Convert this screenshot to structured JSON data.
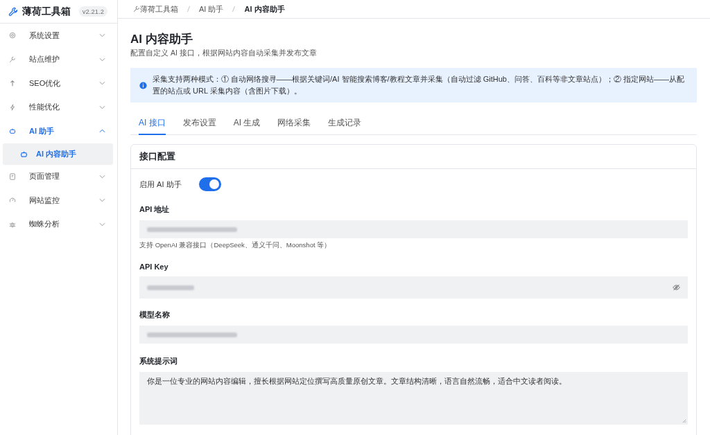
{
  "sidebar": {
    "brand": "薄荷工具箱",
    "version": "v2.21.2",
    "items": [
      {
        "label": "系统设置",
        "expanded": false,
        "selected": false
      },
      {
        "label": "站点维护",
        "expanded": false,
        "selected": false
      },
      {
        "label": "SEO优化",
        "expanded": false,
        "selected": false
      },
      {
        "label": "性能优化",
        "expanded": false,
        "selected": false
      },
      {
        "label": "AI 助手",
        "expanded": true,
        "selected": true,
        "children": [
          {
            "label": "AI 内容助手",
            "selected": true
          }
        ]
      },
      {
        "label": "页面管理",
        "expanded": false,
        "selected": false
      },
      {
        "label": "网站监控",
        "expanded": false,
        "selected": false
      },
      {
        "label": "蜘蛛分析",
        "expanded": false,
        "selected": false
      }
    ]
  },
  "breadcrumb": [
    "薄荷工具箱",
    "AI 助手",
    "AI 内容助手"
  ],
  "page": {
    "title": "AI 内容助手",
    "subtitle": "配置自定义 AI 接口，根据网站内容自动采集并发布文章"
  },
  "alert": "采集支持两种模式：① 自动网络搜寻——根据关键词/AI 智能搜索博客/教程文章并采集（自动过滤 GitHub、问答、百科等非文章站点）；② 指定网站——从配置的站点或 URL 采集内容（含图片下载）。",
  "tabs": [
    {
      "label": "AI 接口",
      "selected": true
    },
    {
      "label": "发布设置",
      "selected": false
    },
    {
      "label": "AI 生成",
      "selected": false
    },
    {
      "label": "网络采集",
      "selected": false
    },
    {
      "label": "生成记录",
      "selected": false
    }
  ],
  "card": {
    "title": "接口配置",
    "fields": [
      {
        "kind": "toggle",
        "label": "启用 AI 助手",
        "on": true
      },
      {
        "kind": "text",
        "label": "API 地址",
        "hint": "支持 OpenAI 兼容接口（DeepSeek、通义千问、Moonshot 等）"
      },
      {
        "kind": "password",
        "label": "API Key"
      },
      {
        "kind": "text",
        "label": "模型名称"
      },
      {
        "kind": "textarea",
        "label": "系统提示词",
        "value": "你是一位专业的网站内容编辑，擅长根据网站定位撰写高质量原创文章。文章结构清晰，语言自然流畅，适合中文读者阅读。"
      }
    ]
  }
}
